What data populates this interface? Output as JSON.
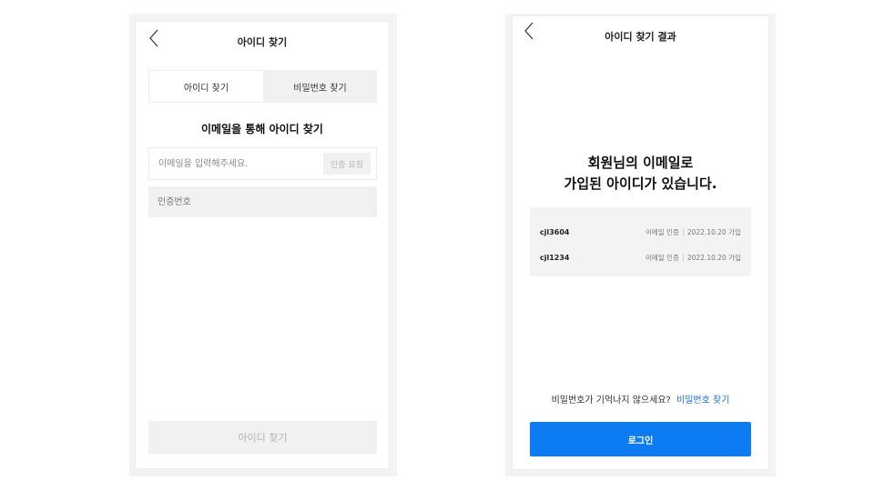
{
  "find_id": {
    "title": "아이디 찾기",
    "tabs": [
      {
        "label": "아이디 찾기",
        "active": true
      },
      {
        "label": "비밀번호 찾기",
        "active": false
      }
    ],
    "heading": "이메일을 통해 아이디 찾기",
    "email_placeholder": "이메일을 입력해주세요.",
    "request_button": "인증 요청",
    "code_placeholder": "인증번호",
    "submit_button": "아이디 찾기"
  },
  "result": {
    "title": "아이디 찾기 결과",
    "heading_line1": "회원님의 이메일로",
    "heading_line2": "가입된 아이디가 있습니다.",
    "accounts": [
      {
        "id": "cjl3604",
        "method": "이메일 인증",
        "joined": "2022.10.20 가입"
      },
      {
        "id": "cjl1234",
        "method": "이메일 인증",
        "joined": "2022.10.20 가입"
      }
    ],
    "prompt": "비밀번호가 기억나지 않으세요?",
    "prompt_link": "비밀번호 찾기",
    "login_button": "로그인"
  },
  "colors": {
    "accent": "#0d7cf2",
    "link": "#1a73e8",
    "panel_bg": "#f3f3f3",
    "disabled_text": "#b3b3b3"
  },
  "icons": {
    "back": "chevron-left-icon"
  }
}
